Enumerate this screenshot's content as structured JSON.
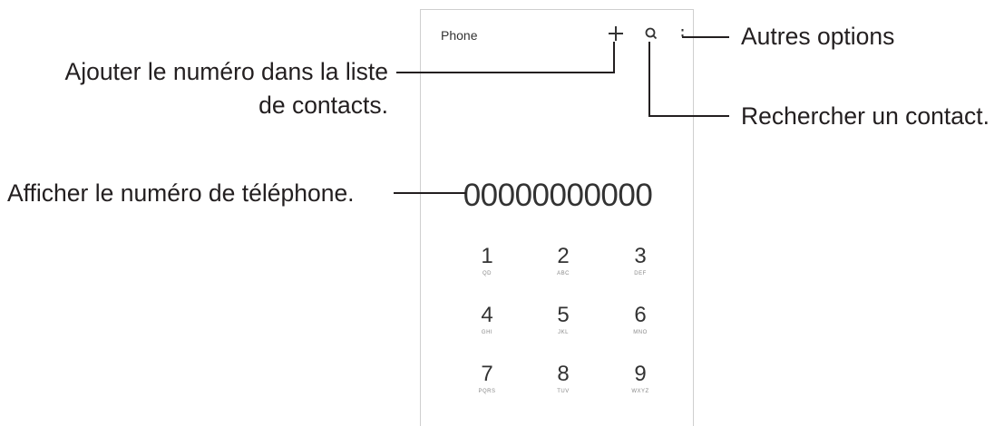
{
  "phone": {
    "title": "Phone",
    "number": "00000000000",
    "keys": [
      {
        "digit": "1",
        "letters": "QD"
      },
      {
        "digit": "2",
        "letters": "ABC"
      },
      {
        "digit": "3",
        "letters": "DEF"
      },
      {
        "digit": "4",
        "letters": "GHI"
      },
      {
        "digit": "5",
        "letters": "JKL"
      },
      {
        "digit": "6",
        "letters": "MNO"
      },
      {
        "digit": "7",
        "letters": "PQRS"
      },
      {
        "digit": "8",
        "letters": "TUV"
      },
      {
        "digit": "9",
        "letters": "WXYZ"
      }
    ],
    "icons": {
      "add": "plus-icon",
      "search": "search-icon",
      "more": "more-vertical-icon"
    }
  },
  "callouts": {
    "more_options": "Autres options",
    "add_contact_line1": "Ajouter le numéro dans la liste",
    "add_contact_line2": "de contacts.",
    "search_contact": "Rechercher un contact.",
    "show_number": "Afficher le numéro de téléphone."
  }
}
